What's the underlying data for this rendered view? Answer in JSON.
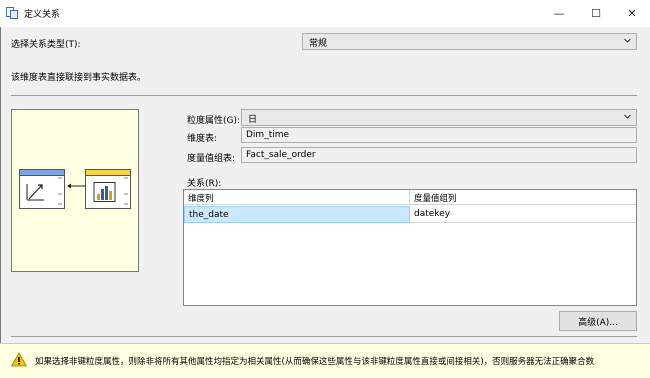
{
  "window": {
    "title": "定义关系",
    "minimize": "—",
    "maximize": "☐",
    "close": "✕"
  },
  "relationship_type": {
    "label": "选择关系类型(T):",
    "value": "常规"
  },
  "description": "该维度表直接联接到事实数据表。",
  "granularity": {
    "label": "粒度属性(G):",
    "value": "日"
  },
  "dimension_table": {
    "label": "维度表:",
    "value": "Dim_time"
  },
  "measure_group_table": {
    "label": "度量值组表:",
    "value": "Fact_sale_order"
  },
  "relationships": {
    "label": "关系(R):",
    "columns": [
      "维度列",
      "度量值组列"
    ],
    "rows": [
      {
        "dimension_column": "the_date",
        "measure_group_column": "datekey"
      }
    ]
  },
  "advanced_button": "高级(A)...",
  "warning": "如果选择非键粒度属性，则除非将所有其他属性均指定为相关属性(从而确保这些属性与该非键粒度属性直接或间接相关)，否则服务器无法正确聚合数",
  "colors": {
    "dimension_header": "#7ea6e0",
    "fact_header": "#f5d44b",
    "diagram_bg": "#ffffe1",
    "selected_row": "#cce8ff"
  }
}
